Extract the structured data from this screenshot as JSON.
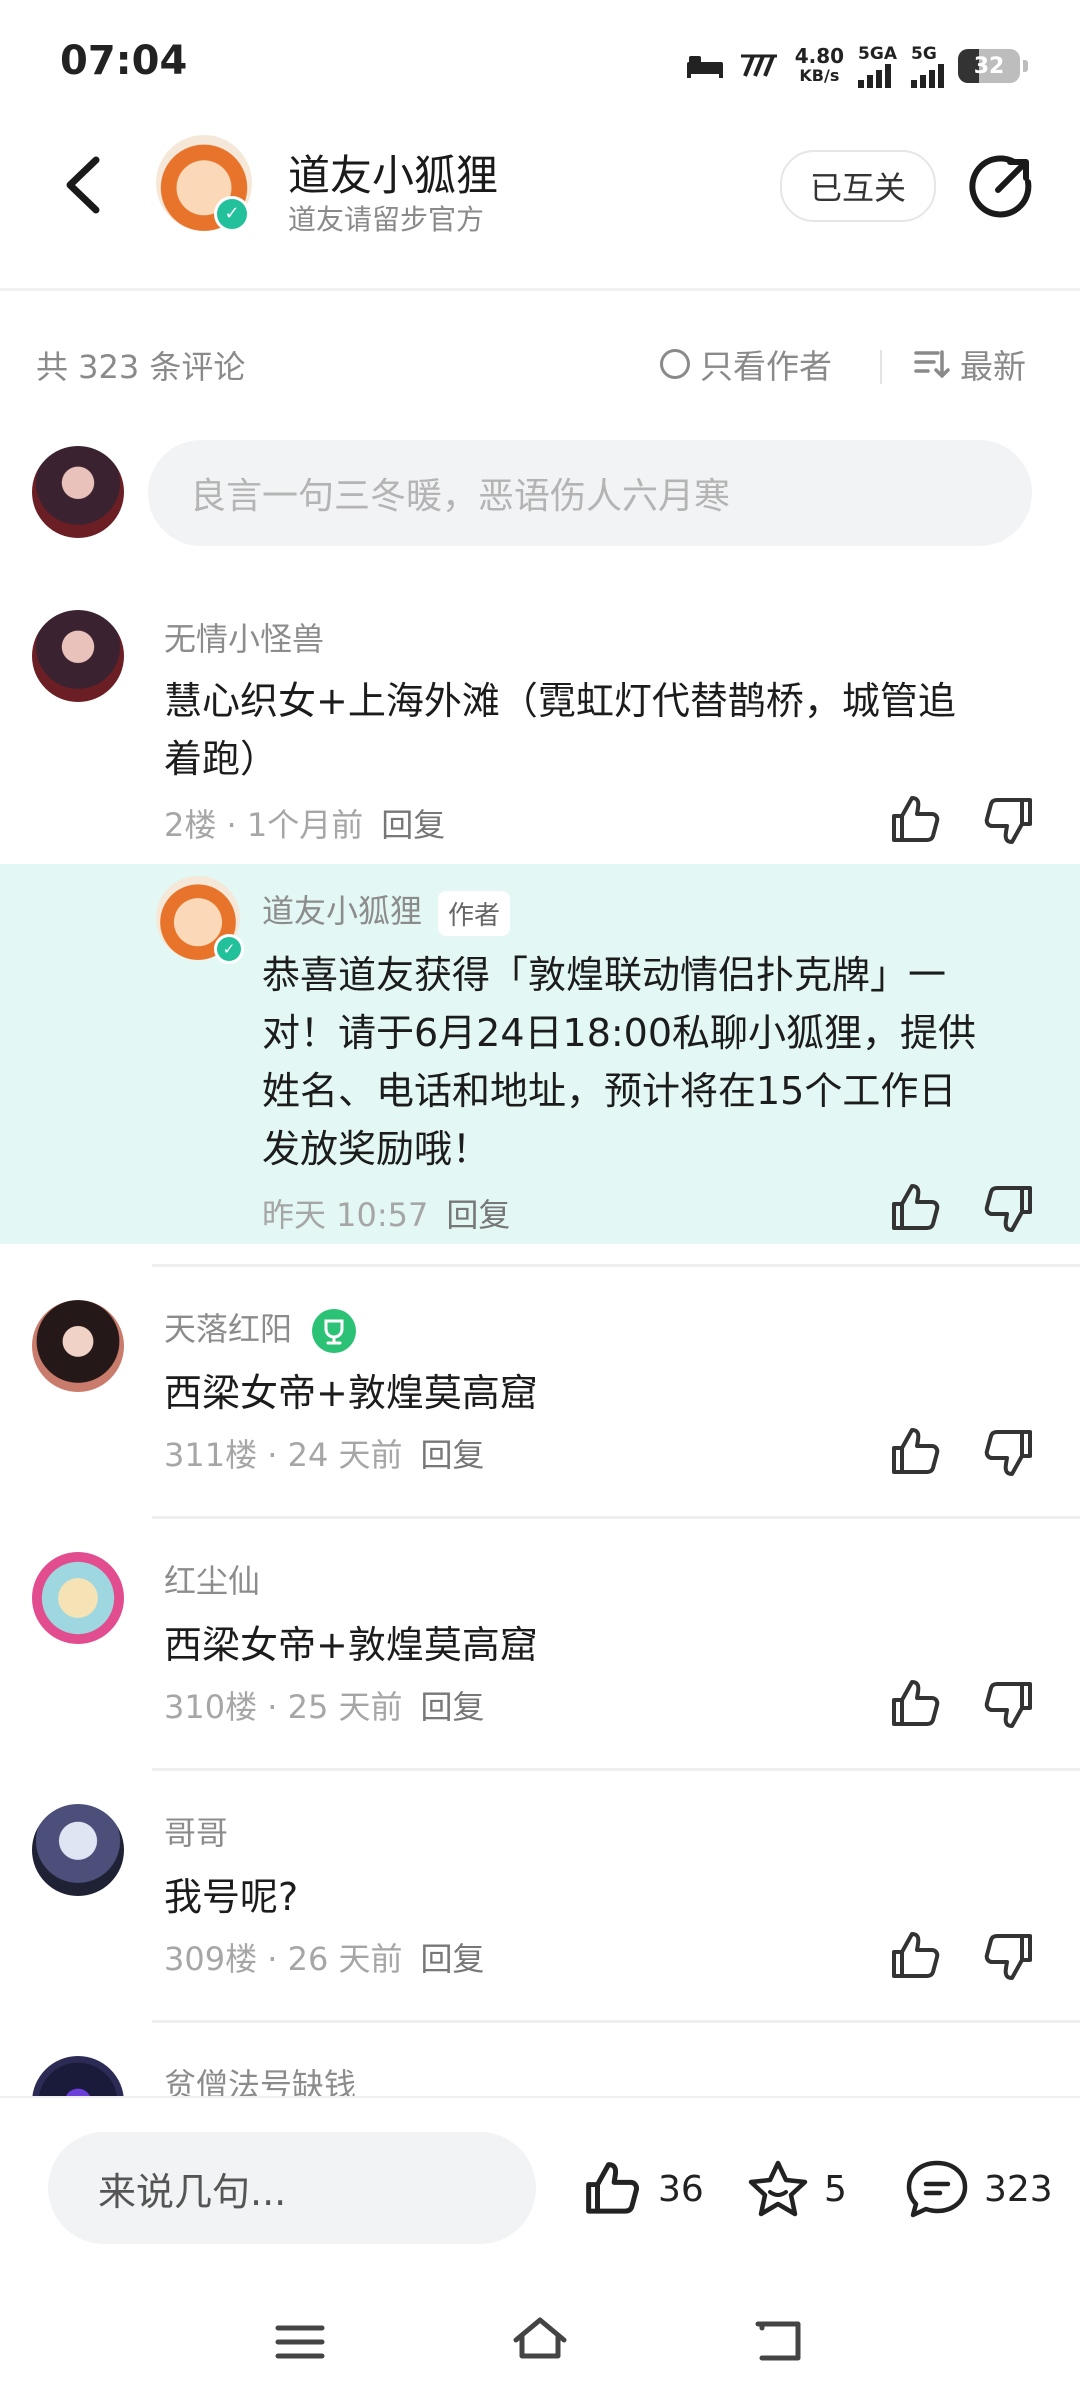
{
  "status_bar": {
    "time": "07:04",
    "net_speed_value": "4.80",
    "net_speed_unit": "KB/s",
    "signal1_label": "5GA",
    "signal2_label": "5G",
    "battery": "32"
  },
  "header": {
    "name": "道友小狐狸",
    "subtitle": "道友请留步官方",
    "follow_label": "已互关"
  },
  "filter": {
    "count_text": "共 323 条评论",
    "author_only_label": "只看作者",
    "sort_label": "最新"
  },
  "composer": {
    "placeholder": "良言一句三冬暖，恶语伤人六月寒"
  },
  "comments": [
    {
      "name": "无情小怪兽",
      "text_line1": "慧心织女+上海外滩（霓虹灯代替鹊桥，城管追",
      "text_line2": "着跑）",
      "meta": "2楼 · 1个月前",
      "reply_label": "回复"
    },
    {
      "name": "天落红阳",
      "text": "西梁女帝+敦煌莫高窟",
      "meta": "311楼 · 24 天前",
      "reply_label": "回复"
    },
    {
      "name": "红尘仙",
      "text": "西梁女帝+敦煌莫高窟",
      "meta": "310楼 · 25 天前",
      "reply_label": "回复"
    },
    {
      "name": "哥哥",
      "text": "我号呢?",
      "meta": "309楼 · 26 天前",
      "reply_label": "回复"
    },
    {
      "name": "贫僧法号缺钱"
    }
  ],
  "author_reply": {
    "name": "道友小狐狸",
    "tag": "作者",
    "line1": "恭喜道友获得「敦煌联动情侣扑克牌」一",
    "line2": "对！请于6月24日18:00私聊小狐狸，提供",
    "line3": "姓名、电话和地址，预计将在15个工作日",
    "line4": "发放奖励哦！",
    "meta": "昨天 10:57",
    "reply_label": "回复"
  },
  "bottom_bar": {
    "placeholder": "来说几句...",
    "likes": "36",
    "favorites": "5",
    "comments": "323"
  },
  "colors": {
    "accent_green": "#23c19b",
    "reply_bg": "#e3f7f4"
  }
}
